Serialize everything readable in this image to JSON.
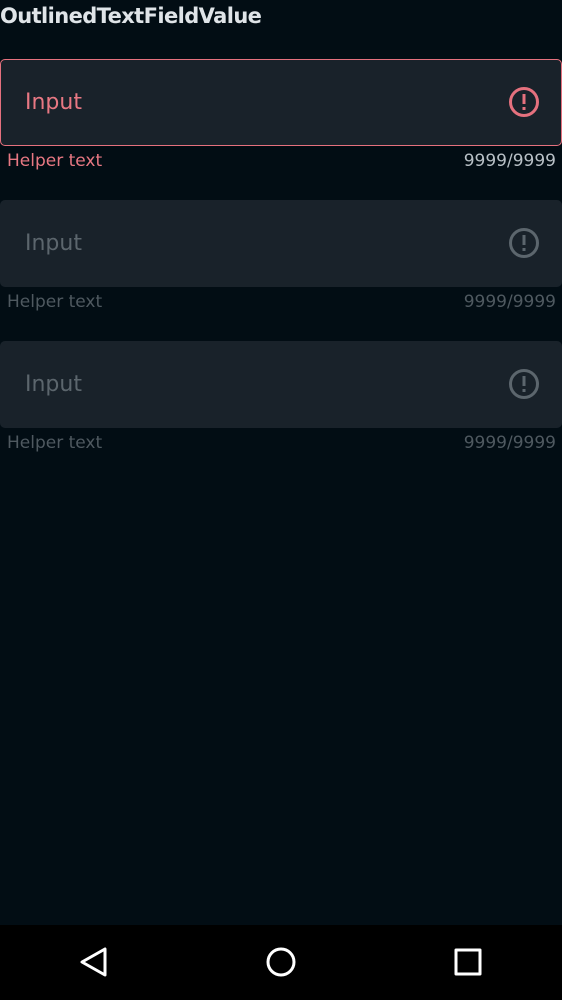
{
  "app": {
    "title": "OutlinedTextFieldValue"
  },
  "fields": [
    {
      "state": "error",
      "input_value": "Input",
      "helper_text": "Helper text",
      "counter": "9999/9999",
      "icon": "error-icon",
      "accent_color": "#e5717e"
    },
    {
      "state": "disabled",
      "input_value": "Input",
      "helper_text": "Helper text",
      "counter": "9999/9999",
      "icon": "error-icon"
    },
    {
      "state": "disabled",
      "input_value": "Input",
      "helper_text": "Helper text",
      "counter": "9999/9999",
      "icon": "error-icon"
    }
  ],
  "navigation": {
    "buttons": [
      {
        "icon": "back-triangle-icon"
      },
      {
        "icon": "home-circle-icon"
      },
      {
        "icon": "recents-square-icon"
      }
    ]
  },
  "colors": {
    "background": "#020d14",
    "field_fill": "#19222a",
    "error": "#e5717e",
    "disabled_text": "#5c666d"
  }
}
